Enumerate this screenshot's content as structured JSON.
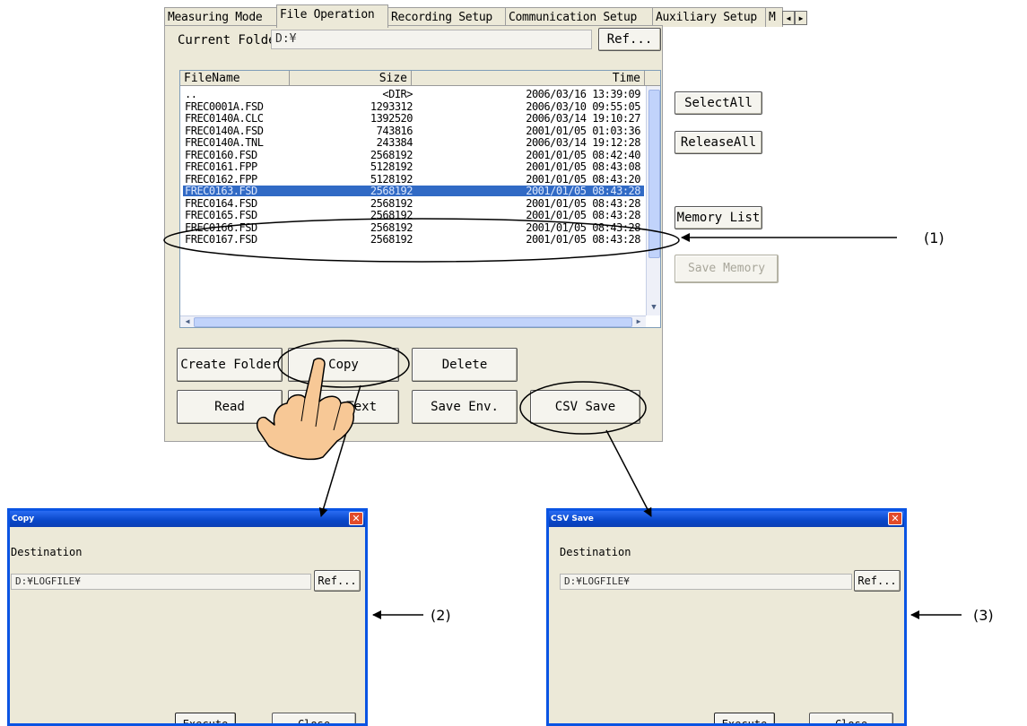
{
  "tabs": [
    "Measuring Mode",
    "File Operation",
    "Recording Setup",
    "Communication Setup",
    "Auxiliary Setup",
    "M"
  ],
  "active_tab": "File Operation",
  "current_folder": {
    "label": "Current Folder",
    "value": "D:¥",
    "ref_button": "Ref..."
  },
  "file_list": {
    "columns": [
      "FileName",
      "Size",
      "Time"
    ],
    "rows": [
      {
        "name": "..",
        "size": "<DIR>",
        "time": "2006/03/16 13:39:09"
      },
      {
        "name": "FREC0001A.FSD",
        "size": "1293312",
        "time": "2006/03/10 09:55:05"
      },
      {
        "name": "FREC0140A.CLC",
        "size": "1392520",
        "time": "2006/03/14 19:10:27"
      },
      {
        "name": "FREC0140A.FSD",
        "size": "743816",
        "time": "2001/01/05 01:03:36"
      },
      {
        "name": "FREC0140A.TNL",
        "size": "243384",
        "time": "2006/03/14 19:12:28"
      },
      {
        "name": "FREC0160.FSD",
        "size": "2568192",
        "time": "2001/01/05 08:42:40"
      },
      {
        "name": "FREC0161.FPP",
        "size": "5128192",
        "time": "2001/01/05 08:43:08"
      },
      {
        "name": "FREC0162.FPP",
        "size": "5128192",
        "time": "2001/01/05 08:43:20"
      },
      {
        "name": "FREC0163.FSD",
        "size": "2568192",
        "time": "2001/01/05 08:43:28"
      },
      {
        "name": "FREC0164.FSD",
        "size": "2568192",
        "time": "2001/01/05 08:43:28"
      },
      {
        "name": "FREC0165.FSD",
        "size": "2568192",
        "time": "2001/01/05 08:43:28"
      },
      {
        "name": "FREC0166.FSD",
        "size": "2568192",
        "time": "2001/01/05 08:43:28"
      },
      {
        "name": "FREC0167.FSD",
        "size": "2568192",
        "time": "2001/01/05 08:43:28"
      }
    ],
    "selected_index": 8
  },
  "side_buttons": {
    "select_all": "SelectAll",
    "release_all": "ReleaseAll",
    "memory_list": "Memory List",
    "save_memory": "Save Memory"
  },
  "bottom_buttons": {
    "create_folder": "Create Folder",
    "copy": "Copy",
    "delete": "Delete",
    "read": "Read",
    "save_text": "Save Text",
    "save_env": "Save Env.",
    "csv_save": "CSV Save"
  },
  "copy_dialog": {
    "title": "Copy",
    "destination_label": "Destination",
    "destination_value": "D:¥LOGFILE¥",
    "ref": "Ref...",
    "execute": "Execute",
    "close": "Close",
    "close_glyph": "✕"
  },
  "csv_dialog": {
    "title": "CSV Save",
    "destination_label": "Destination",
    "destination_value": "D:¥LOGFILE¥",
    "ref": "Ref...",
    "execute": "Execute",
    "close": "Close",
    "close_glyph": "✕"
  },
  "callouts": [
    "(1)",
    "(2)",
    "(3)"
  ],
  "colors": {
    "selection": "#316ac5",
    "titlebar": "#0a54e3",
    "panel": "#ece9d8",
    "hand": "#f7c896"
  }
}
